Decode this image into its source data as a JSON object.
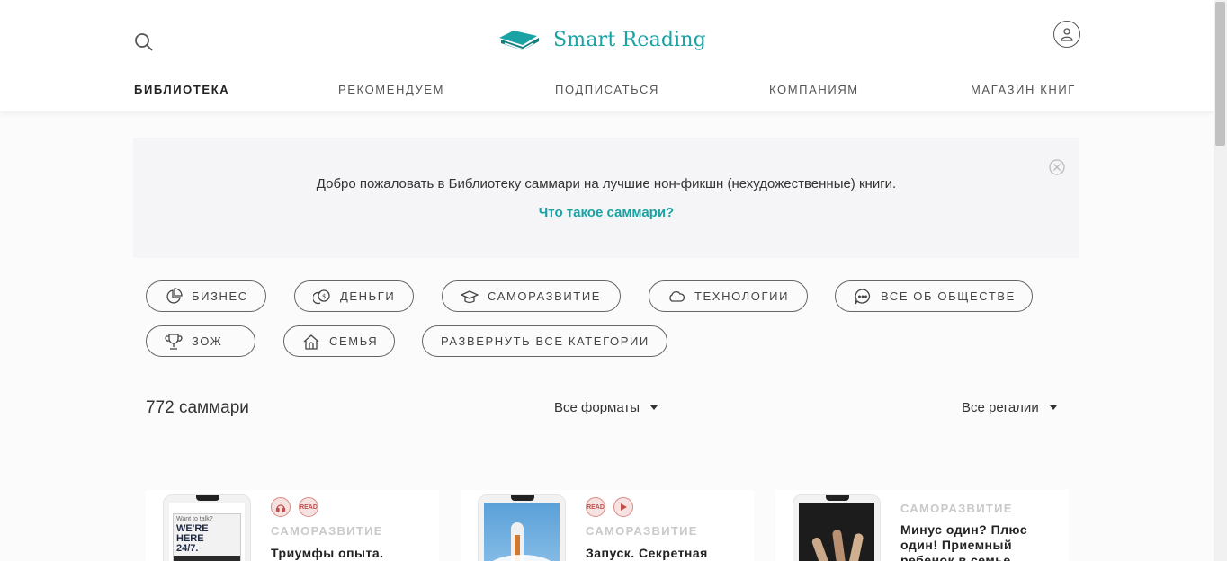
{
  "header": {
    "logo_text": "Smart Reading",
    "nav": [
      {
        "label": "БИБЛИОТЕКА",
        "active": true
      },
      {
        "label": "РЕКОМЕНДУЕМ"
      },
      {
        "label": "ПОДПИСАТЬСЯ"
      },
      {
        "label": "КОМПАНИЯМ"
      },
      {
        "label": "МАГАЗИН КНИГ"
      }
    ]
  },
  "welcome": {
    "text": "Добро пожаловать в Библиотеку саммари на лучшие нон-фикшн (нехудожественные) книги.",
    "link": "Что такое саммари?"
  },
  "categories": [
    {
      "label": "БИЗНЕС",
      "icon": "pie-chart-icon"
    },
    {
      "label": "ДЕНЬГИ",
      "icon": "coins-icon"
    },
    {
      "label": "САМОРАЗВИТИЕ",
      "icon": "graduation-cap-icon"
    },
    {
      "label": "ТЕХНОЛОГИИ",
      "icon": "cloud-icon"
    },
    {
      "label": "ВСЕ ОБ ОБЩЕСТВЕ",
      "icon": "chat-bubble-icon"
    },
    {
      "label": "ЗОЖ",
      "icon": "trophy-icon"
    },
    {
      "label": "СЕМЬЯ",
      "icon": "house-icon"
    },
    {
      "label": "РАЗВЕРНУТЬ ВСЕ КАТЕГОРИИ"
    }
  ],
  "listing": {
    "count": "772 саммари",
    "format_filter": "Все форматы",
    "regalia_filter": "Все регалии"
  },
  "cards": [
    {
      "category": "САМОРАЗВИТИЕ",
      "title": "Триумфы опыта.",
      "cover_text": [
        "Want to talk?",
        "WE'RE HERE",
        "24/7."
      ],
      "badges": [
        "audio-icon",
        "READ"
      ]
    },
    {
      "category": "САМОРАЗВИТИЕ",
      "title": "Запуск. Секретная",
      "badges": [
        "READ",
        "video-icon"
      ]
    },
    {
      "category": "САМОРАЗВИТИЕ",
      "title": "Минус один? Плюс один! Приемный ребенок в семье",
      "badges": []
    }
  ],
  "colors": {
    "accent": "#1aa2a4",
    "badge": "#c0504d"
  }
}
